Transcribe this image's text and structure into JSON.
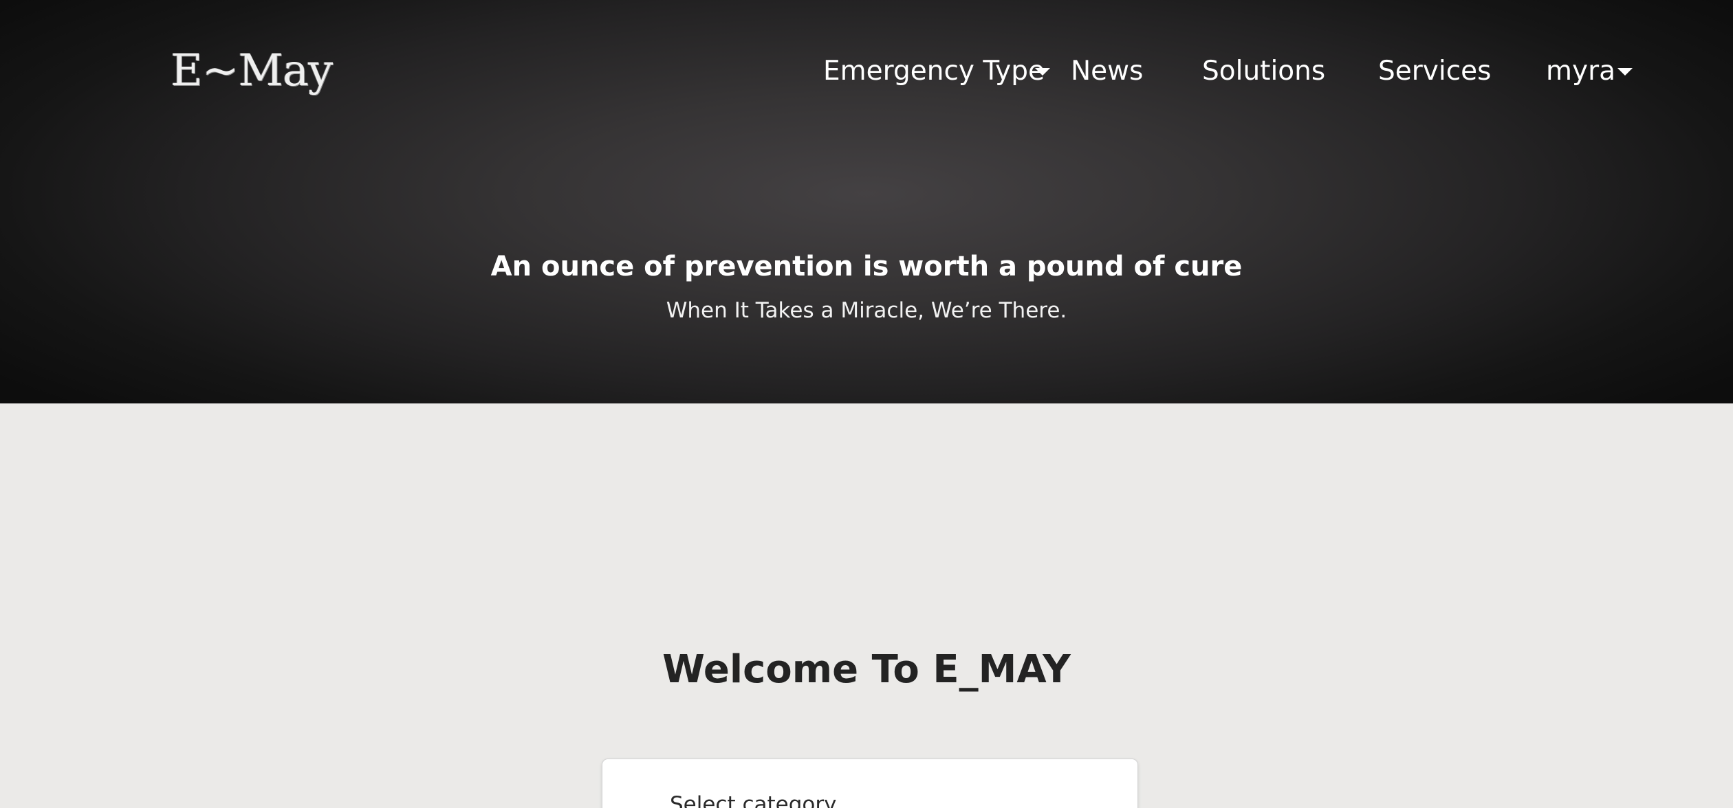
{
  "header": {
    "logo_text": "E~May",
    "nav": {
      "emergency_type": "Emergency Type",
      "news": "News",
      "solutions": "Solutions",
      "services": "Services",
      "user": "myra"
    }
  },
  "hero": {
    "tagline": "An ounce of prevention is worth a pound of cure",
    "subtagline": "When It Takes a Miracle, We’re There."
  },
  "main": {
    "welcome_title": "Welcome To E_MAY",
    "category_select_label": "Select category"
  },
  "colors": {
    "hero_dark": "#121212",
    "hero_center": "#444143",
    "page_background": "#ebeae8",
    "nav_text": "#ffffff",
    "heading_text": "#232323"
  },
  "icons": {
    "dropdown": "caret-down-icon"
  }
}
